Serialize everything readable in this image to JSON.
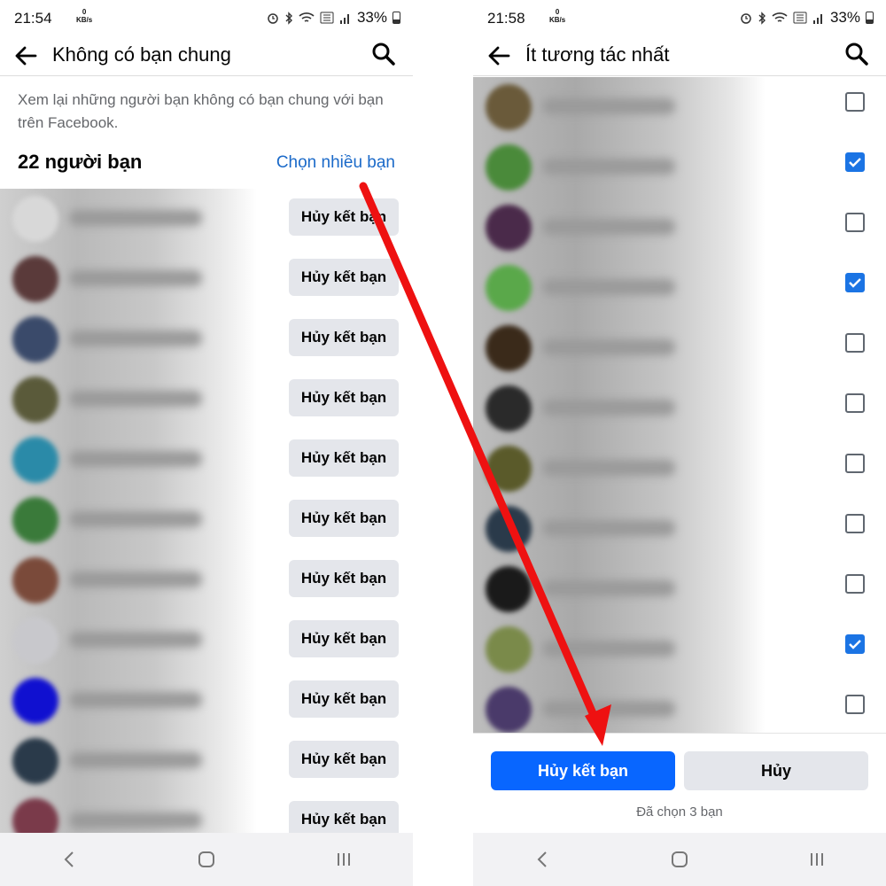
{
  "left": {
    "status": {
      "time": "21:54",
      "net_value": "0",
      "net_unit": "KB/s",
      "battery": "33%"
    },
    "appbar": {
      "title": "Không có bạn chung"
    },
    "description": "Xem lại những người bạn không có bạn chung với bạn trên Facebook.",
    "friends_count": "22 người bạn",
    "select_many": "Chọn nhiều bạn",
    "unfriend_label": "Hủy kết bạn",
    "avatar_colors": [
      "#d8d8d8",
      "#5a3a3a",
      "#3a4a6a",
      "#5a5a3a",
      "#2a8aa8",
      "#3a7a3a",
      "#7a4a3a",
      "#c8c8cc",
      "#1010d0",
      "#2a3a4a",
      "#7a3a4a"
    ]
  },
  "right": {
    "status": {
      "time": "21:58",
      "net_value": "0",
      "net_unit": "KB/s",
      "battery": "33%"
    },
    "appbar": {
      "title": "Ít tương tác nhất"
    },
    "checked": [
      false,
      true,
      false,
      true,
      false,
      false,
      false,
      false,
      false,
      true,
      false
    ],
    "avatar_colors": [
      "#6a5a3a",
      "#4a8a3a",
      "#4a2a4a",
      "#5aa84a",
      "#3a2a1a",
      "#2a2a2a",
      "#5a5a2a",
      "#2a3a4a",
      "#1a1a1a",
      "#7a8a4a",
      "#4a3a6a"
    ],
    "confirm_label": "Hủy kết bạn",
    "cancel_label": "Hủy",
    "selected_text": "Đã chọn 3 bạn"
  },
  "colors": {
    "fb_blue": "#0866ff",
    "link_blue": "#1b6ac9",
    "checkbox_blue": "#1b74e4",
    "arrow_red": "#ee1111"
  }
}
